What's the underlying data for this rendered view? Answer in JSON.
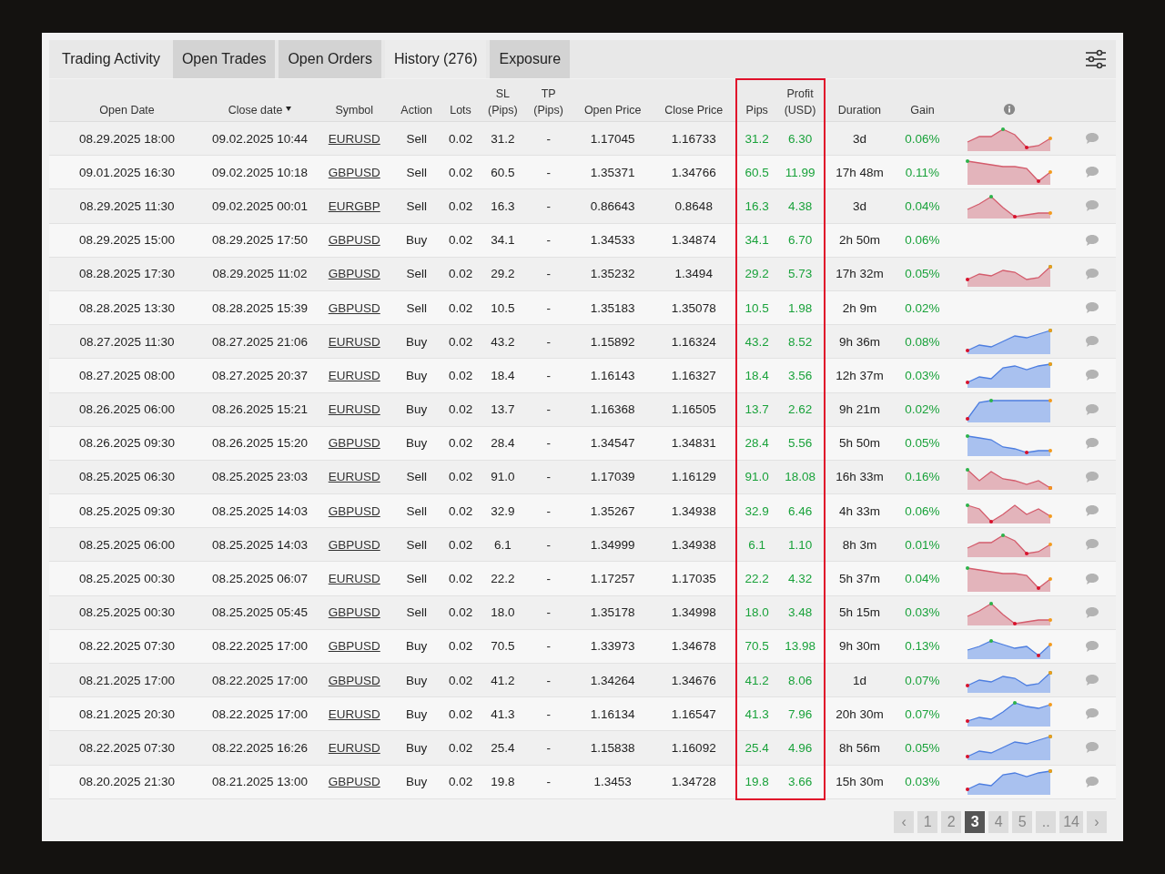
{
  "panel": {
    "title": "Trading Activity",
    "tabs": [
      {
        "label": "Open Trades",
        "selected": false
      },
      {
        "label": "Open Orders",
        "selected": false
      },
      {
        "label": "History (276)",
        "selected": true
      },
      {
        "label": "Exposure",
        "selected": false
      }
    ]
  },
  "table": {
    "columns": [
      {
        "label": "Open Date",
        "kind": "text",
        "sorted": false,
        "highlighted": false
      },
      {
        "label": "Close date",
        "kind": "text",
        "sorted": true,
        "highlighted": false
      },
      {
        "label": "Symbol",
        "kind": "link",
        "sorted": false,
        "highlighted": false
      },
      {
        "label": "Action",
        "kind": "text",
        "sorted": false,
        "highlighted": false
      },
      {
        "label": "Lots",
        "kind": "text",
        "sorted": false,
        "highlighted": false
      },
      {
        "label": "SL (Pips)",
        "kind": "text",
        "sorted": false,
        "highlighted": false
      },
      {
        "label": "TP (Pips)",
        "kind": "text",
        "sorted": false,
        "highlighted": false
      },
      {
        "label": "Open Price",
        "kind": "text",
        "sorted": false,
        "highlighted": false
      },
      {
        "label": "Close Price",
        "kind": "text",
        "sorted": false,
        "highlighted": false
      },
      {
        "label": "Pips",
        "kind": "profit",
        "sorted": false,
        "highlighted": true
      },
      {
        "label": "Profit (USD)",
        "kind": "profit",
        "sorted": false,
        "highlighted": true
      },
      {
        "label": "Duration",
        "kind": "text",
        "sorted": false,
        "highlighted": false
      },
      {
        "label": "Gain",
        "kind": "profit",
        "sorted": false,
        "highlighted": false
      }
    ],
    "rows": [
      {
        "cells": [
          "08.29.2025 18:00",
          "09.02.2025 10:44",
          "EURUSD",
          "Sell",
          "0.02",
          "31.2",
          "-",
          "1.17045",
          "1.16733",
          "31.2",
          "6.30",
          "3d",
          "0.06%"
        ],
        "color": "#e3b4bb"
      },
      {
        "cells": [
          "09.01.2025 16:30",
          "09.02.2025 10:18",
          "GBPUSD",
          "Sell",
          "0.02",
          "60.5",
          "-",
          "1.35371",
          "1.34766",
          "60.5",
          "11.99",
          "17h 48m",
          "0.11%"
        ],
        "color": "#e3b4bb"
      },
      {
        "cells": [
          "08.29.2025 11:30",
          "09.02.2025 00:01",
          "EURGBP",
          "Sell",
          "0.02",
          "16.3",
          "-",
          "0.86643",
          "0.8648",
          "16.3",
          "4.38",
          "3d",
          "0.04%"
        ],
        "color": "#e3b4bb"
      },
      {
        "cells": [
          "08.29.2025 15:00",
          "08.29.2025 17:50",
          "GBPUSD",
          "Buy",
          "0.02",
          "34.1",
          "-",
          "1.34533",
          "1.34874",
          "34.1",
          "6.70",
          "2h 50m",
          "0.06%"
        ]
      },
      {
        "cells": [
          "08.28.2025 17:30",
          "08.29.2025 11:02",
          "GBPUSD",
          "Sell",
          "0.02",
          "29.2",
          "-",
          "1.35232",
          "1.3494",
          "29.2",
          "5.73",
          "17h 32m",
          "0.05%"
        ],
        "color": "#e3b4bb"
      },
      {
        "cells": [
          "08.28.2025 13:30",
          "08.28.2025 15:39",
          "GBPUSD",
          "Sell",
          "0.02",
          "10.5",
          "-",
          "1.35183",
          "1.35078",
          "10.5",
          "1.98",
          "2h 9m",
          "0.02%"
        ]
      },
      {
        "cells": [
          "08.27.2025 11:30",
          "08.27.2025 21:06",
          "EURUSD",
          "Buy",
          "0.02",
          "43.2",
          "-",
          "1.15892",
          "1.16324",
          "43.2",
          "8.52",
          "9h 36m",
          "0.08%"
        ],
        "color": "#a9c1ef"
      },
      {
        "cells": [
          "08.27.2025 08:00",
          "08.27.2025 20:37",
          "EURUSD",
          "Buy",
          "0.02",
          "18.4",
          "-",
          "1.16143",
          "1.16327",
          "18.4",
          "3.56",
          "12h 37m",
          "0.03%"
        ],
        "color": "#a9c1ef"
      },
      {
        "cells": [
          "08.26.2025 06:00",
          "08.26.2025 15:21",
          "EURUSD",
          "Buy",
          "0.02",
          "13.7",
          "-",
          "1.16368",
          "1.16505",
          "13.7",
          "2.62",
          "9h 21m",
          "0.02%"
        ],
        "color": "#a9c1ef"
      },
      {
        "cells": [
          "08.26.2025 09:30",
          "08.26.2025 15:20",
          "GBPUSD",
          "Buy",
          "0.02",
          "28.4",
          "-",
          "1.34547",
          "1.34831",
          "28.4",
          "5.56",
          "5h 50m",
          "0.05%"
        ],
        "color": "#a9c1ef"
      },
      {
        "cells": [
          "08.25.2025 06:30",
          "08.25.2025 23:03",
          "EURUSD",
          "Sell",
          "0.02",
          "91.0",
          "-",
          "1.17039",
          "1.16129",
          "91.0",
          "18.08",
          "16h 33m",
          "0.16%"
        ],
        "color": "#e3b4bb"
      },
      {
        "cells": [
          "08.25.2025 09:30",
          "08.25.2025 14:03",
          "GBPUSD",
          "Sell",
          "0.02",
          "32.9",
          "-",
          "1.35267",
          "1.34938",
          "32.9",
          "6.46",
          "4h 33m",
          "0.06%"
        ],
        "color": "#e3b4bb"
      },
      {
        "cells": [
          "08.25.2025 06:00",
          "08.25.2025 14:03",
          "GBPUSD",
          "Sell",
          "0.02",
          "6.1",
          "-",
          "1.34999",
          "1.34938",
          "6.1",
          "1.10",
          "8h 3m",
          "0.01%"
        ],
        "color": "#e3b4bb"
      },
      {
        "cells": [
          "08.25.2025 00:30",
          "08.25.2025 06:07",
          "EURUSD",
          "Sell",
          "0.02",
          "22.2",
          "-",
          "1.17257",
          "1.17035",
          "22.2",
          "4.32",
          "5h 37m",
          "0.04%"
        ],
        "color": "#e3b4bb"
      },
      {
        "cells": [
          "08.25.2025 00:30",
          "08.25.2025 05:45",
          "GBPUSD",
          "Sell",
          "0.02",
          "18.0",
          "-",
          "1.35178",
          "1.34998",
          "18.0",
          "3.48",
          "5h 15m",
          "0.03%"
        ],
        "color": "#e3b4bb"
      },
      {
        "cells": [
          "08.22.2025 07:30",
          "08.22.2025 17:00",
          "GBPUSD",
          "Buy",
          "0.02",
          "70.5",
          "-",
          "1.33973",
          "1.34678",
          "70.5",
          "13.98",
          "9h 30m",
          "0.13%"
        ],
        "color": "#a9c1ef"
      },
      {
        "cells": [
          "08.21.2025 17:00",
          "08.22.2025 17:00",
          "GBPUSD",
          "Buy",
          "0.02",
          "41.2",
          "-",
          "1.34264",
          "1.34676",
          "41.2",
          "8.06",
          "1d",
          "0.07%"
        ],
        "color": "#a9c1ef"
      },
      {
        "cells": [
          "08.21.2025 20:30",
          "08.22.2025 17:00",
          "EURUSD",
          "Buy",
          "0.02",
          "41.3",
          "-",
          "1.16134",
          "1.16547",
          "41.3",
          "7.96",
          "20h 30m",
          "0.07%"
        ],
        "color": "#a9c1ef"
      },
      {
        "cells": [
          "08.22.2025 07:30",
          "08.22.2025 16:26",
          "EURUSD",
          "Buy",
          "0.02",
          "25.4",
          "-",
          "1.15838",
          "1.16092",
          "25.4",
          "4.96",
          "8h 56m",
          "0.05%"
        ],
        "color": "#a9c1ef"
      },
      {
        "cells": [
          "08.20.2025 21:30",
          "08.21.2025 13:00",
          "GBPUSD",
          "Buy",
          "0.02",
          "19.8",
          "-",
          "1.3453",
          "1.34728",
          "19.8",
          "3.66",
          "15h 30m",
          "0.03%"
        ],
        "color": "#a9c1ef"
      }
    ]
  },
  "pagination": {
    "prev": "‹",
    "next": "›",
    "pages": [
      {
        "label": "1",
        "selected": false
      },
      {
        "label": "2",
        "selected": false
      },
      {
        "label": "3",
        "selected": true
      },
      {
        "label": "4",
        "selected": false
      },
      {
        "label": "5",
        "selected": false
      },
      {
        "label": "..",
        "selected": false
      },
      {
        "label": "14",
        "selected": false
      }
    ]
  }
}
